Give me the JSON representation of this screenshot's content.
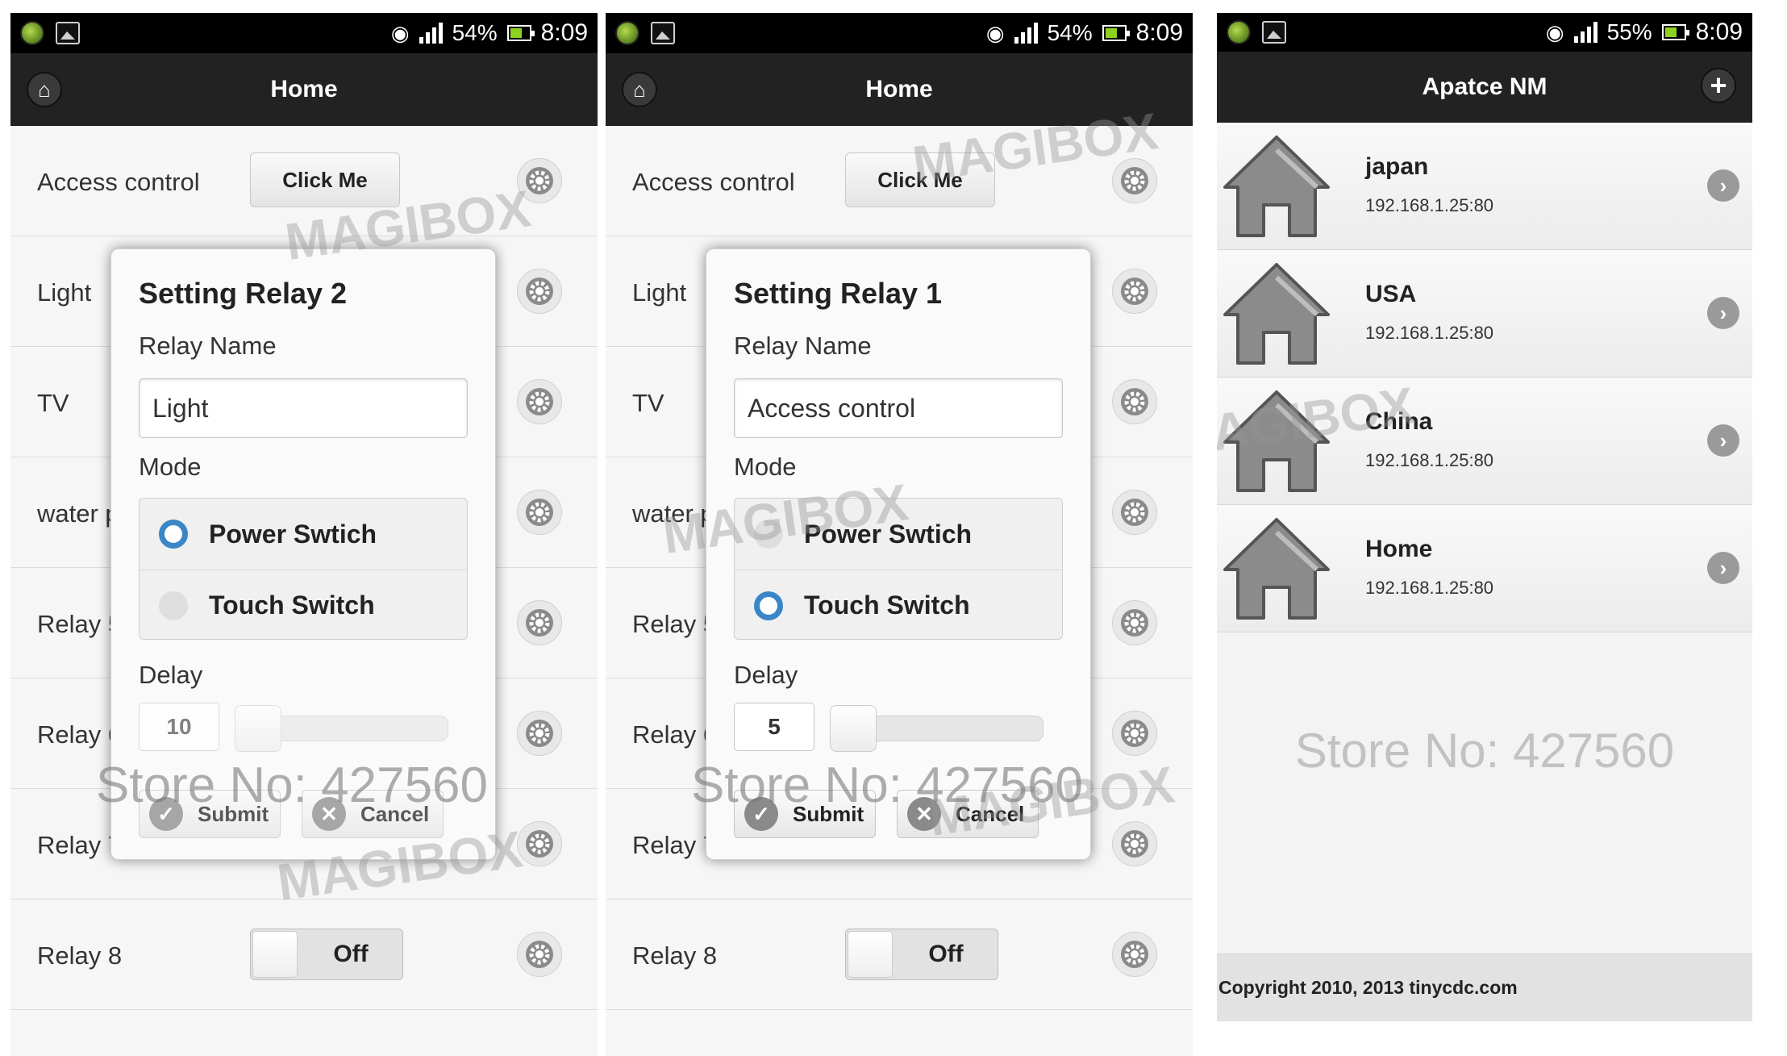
{
  "status": {
    "screen1": {
      "battery": "54%",
      "time": "8:09"
    },
    "screen2": {
      "battery": "54%",
      "time": "8:09"
    },
    "screen3": {
      "battery": "55%",
      "time": "8:09"
    }
  },
  "home_title": "Home",
  "rows": [
    {
      "label": "Access control",
      "control": "button",
      "value": "Click Me"
    },
    {
      "label": "Light"
    },
    {
      "label": "TV"
    },
    {
      "label": "water p"
    },
    {
      "label": "Relay 5"
    },
    {
      "label": "Relay 6"
    },
    {
      "label": "Relay 7"
    },
    {
      "label": "Relay 8",
      "control": "toggle",
      "value": "Off"
    }
  ],
  "dialog1": {
    "title": "Setting Relay 2",
    "name_label": "Relay Name",
    "name_value": "Light",
    "mode_label": "Mode",
    "mode_options": [
      "Power Swtich",
      "Touch Switch"
    ],
    "selected_mode": "Power Swtich",
    "delay_label": "Delay",
    "delay_value": "10",
    "submit": "Submit",
    "cancel": "Cancel"
  },
  "dialog2": {
    "title": "Setting Relay 1",
    "name_label": "Relay Name",
    "name_value": "Access control",
    "mode_label": "Mode",
    "mode_options": [
      "Power Swtich",
      "Touch Switch"
    ],
    "selected_mode": "Touch Switch",
    "delay_label": "Delay",
    "delay_value": "5",
    "submit": "Submit",
    "cancel": "Cancel"
  },
  "list_screen": {
    "title": "Apatce NM",
    "items": [
      {
        "name": "japan",
        "address": "192.168.1.25:80"
      },
      {
        "name": "USA",
        "address": "192.168.1.25:80"
      },
      {
        "name": "China",
        "address": "192.168.1.25:80"
      },
      {
        "name": "Home",
        "address": "192.168.1.25:80"
      }
    ],
    "store": "Store No: 427560",
    "footer": "Copyright 2010, 2013 tinycdc.com"
  },
  "watermarks": {
    "brand": "MAGIBOX",
    "store": "Store No: 427560"
  },
  "icons": {
    "home": "home-icon",
    "settings": "gear-icon",
    "add": "plus-icon",
    "chevron": "chevron-right-icon",
    "submit": "check-icon",
    "cancel": "close-icon"
  },
  "colors": {
    "accent": "#3b86c6",
    "titlebar": "#222222",
    "statusbar": "#000000"
  }
}
